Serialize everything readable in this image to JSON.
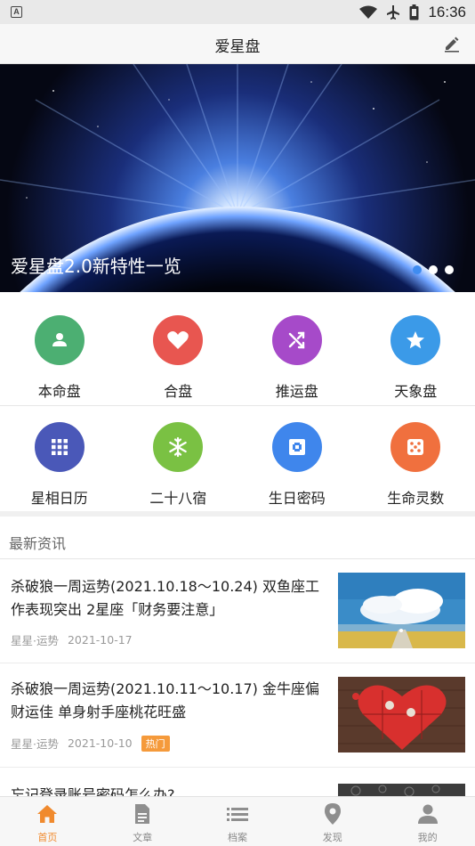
{
  "status_bar": {
    "time": "16:36",
    "notification_letter": "A"
  },
  "header": {
    "title": "爱星盘"
  },
  "banner": {
    "title": "爱星盘2.0新特性一览",
    "slide_count": 3,
    "active_slide": 1
  },
  "menu": [
    {
      "label": "本命盘",
      "color": "#4caf72",
      "icon": "person-icon"
    },
    {
      "label": "合盘",
      "color": "#e85650",
      "icon": "heart-icon"
    },
    {
      "label": "推运盘",
      "color": "#a64ac9",
      "icon": "shuffle-icon"
    },
    {
      "label": "天象盘",
      "color": "#3b9ae8",
      "icon": "star-icon"
    },
    {
      "label": "星相日历",
      "color": "#4a58b8",
      "icon": "grid-icon"
    },
    {
      "label": "二十八宿",
      "color": "#7ac143",
      "icon": "snowflake-icon"
    },
    {
      "label": "生日密码",
      "color": "#3f86ec",
      "icon": "frame-icon"
    },
    {
      "label": "生命灵数",
      "color": "#f0703e",
      "icon": "dice-icon"
    }
  ],
  "news": {
    "section_title": "最新资讯",
    "items": [
      {
        "title": "杀破狼一周运势(2021.10.18～10.24) 双鱼座工作表现突出 2星座「财务要注意」",
        "source": "星星·运势",
        "date": "2021-10-17",
        "badge": ""
      },
      {
        "title": "杀破狼一周运势(2021.10.11～10.17) 金牛座偏财运佳 单身射手座桃花旺盛",
        "source": "星星·运势",
        "date": "2021-10-10",
        "badge": "热门"
      },
      {
        "title": "忘记登录账号密码怎么办?",
        "source": "",
        "date": "",
        "badge": ""
      }
    ]
  },
  "tabs": [
    {
      "label": "首页",
      "icon": "home-icon",
      "active": true
    },
    {
      "label": "文章",
      "icon": "article-icon",
      "active": false
    },
    {
      "label": "档案",
      "icon": "list-icon",
      "active": false
    },
    {
      "label": "发现",
      "icon": "location-pin-icon",
      "active": false
    },
    {
      "label": "我的",
      "icon": "user-icon",
      "active": false
    }
  ],
  "colors": {
    "accent": "#f08a2e",
    "dot_active": "#3f8cf0",
    "hot_badge": "#f59a3b"
  }
}
